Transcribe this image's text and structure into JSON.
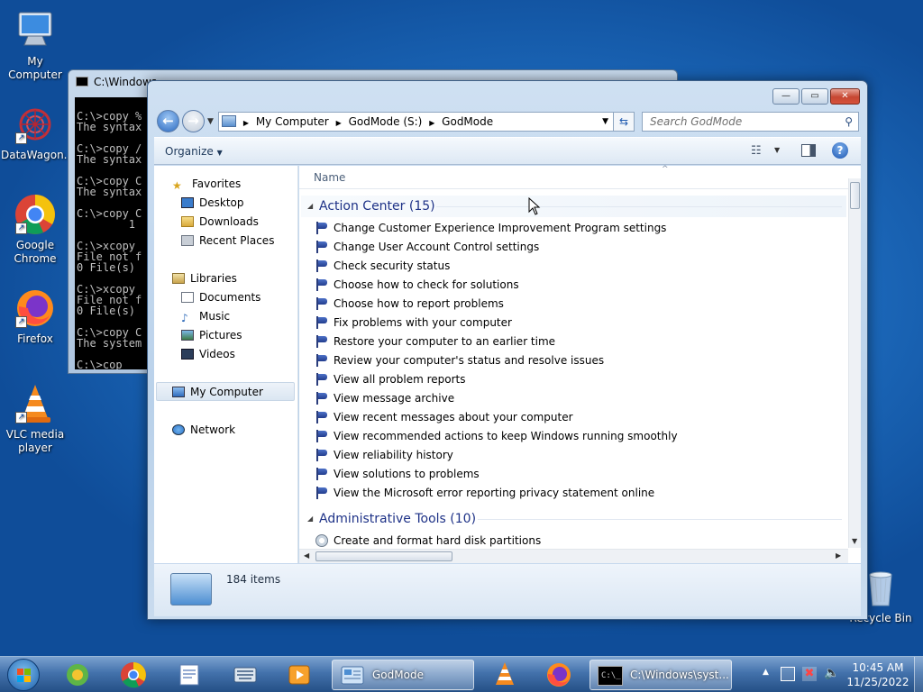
{
  "desktop": {
    "icons": [
      {
        "label": "My Computer",
        "icon": "computer-icon"
      },
      {
        "label": "DataWagon...",
        "icon": "datawagon-icon"
      },
      {
        "label": "Google Chrome",
        "icon": "chrome-icon"
      },
      {
        "label": "Firefox",
        "icon": "firefox-icon"
      },
      {
        "label": "VLC media player",
        "icon": "vlc-icon"
      },
      {
        "label": "Recycle Bin",
        "icon": "recycle-bin-icon"
      }
    ]
  },
  "cmd": {
    "title": "C:\\Windows",
    "lines": [
      "",
      "C:\\>copy %",
      "The syntax",
      "",
      "C:\\>copy /",
      "The syntax",
      "",
      "C:\\>copy C",
      "The syntax",
      "",
      "C:\\>copy C",
      "        1",
      "",
      "C:\\>xcopy",
      "File not f",
      "0 File(s)",
      "",
      "C:\\>xcopy",
      "File not f",
      "0 File(s)",
      "",
      "C:\\>copy C",
      "The system",
      "",
      "C:\\>cop"
    ]
  },
  "explorer": {
    "title_buttons": {
      "minimize": "—",
      "maximize": "▭",
      "close": "✕"
    },
    "breadcrumb": [
      "My Computer",
      "GodMode (S:)",
      "GodMode"
    ],
    "search_placeholder": "Search GodMode",
    "organize": "Organize",
    "nav": {
      "favorites": {
        "label": "Favorites",
        "items": [
          "Desktop",
          "Downloads",
          "Recent Places"
        ]
      },
      "libraries": {
        "label": "Libraries",
        "items": [
          "Documents",
          "Music",
          "Pictures",
          "Videos"
        ]
      },
      "computer": "My Computer",
      "network": "Network"
    },
    "column_header": "Name",
    "groups": [
      {
        "title": "Action Center (15)",
        "items": [
          "Change Customer Experience Improvement Program settings",
          "Change User Account Control settings",
          "Check security status",
          "Choose how to check for solutions",
          "Choose how to report problems",
          "Fix problems with your computer",
          "Restore your computer to an earlier time",
          "Review your computer's status and resolve issues",
          "View all problem reports",
          "View message archive",
          "View recent messages about your computer",
          "View recommended actions to keep Windows running smoothly",
          "View reliability history",
          "View solutions to problems",
          "View the Microsoft error reporting privacy statement online"
        ]
      },
      {
        "title": "Administrative Tools (10)",
        "items": [
          "Create and format hard disk partitions"
        ]
      }
    ],
    "status": {
      "count": "184 items"
    }
  },
  "taskbar": {
    "buttons": [
      {
        "label": "GodMode",
        "icon": "godmode-folder-icon"
      },
      {
        "label": "C:\\Windows\\syst...",
        "icon": "cmd-icon"
      }
    ],
    "clock": {
      "time": "10:45 AM",
      "date": "11/25/2022"
    }
  }
}
